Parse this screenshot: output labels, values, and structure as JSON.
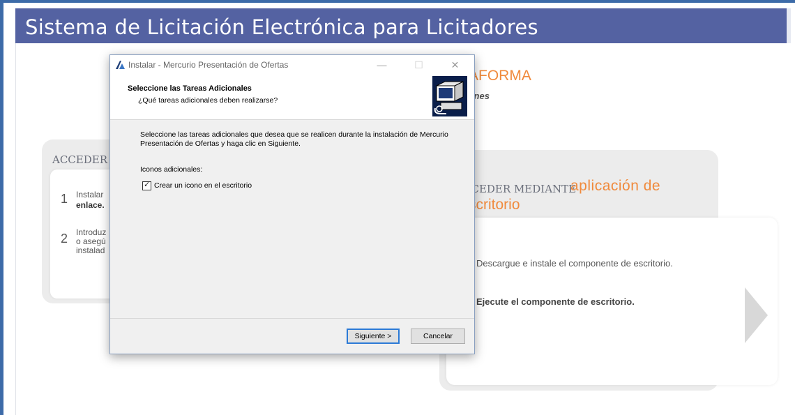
{
  "page": {
    "header_title": "Sistema de Licitación Electrónica para Licitadores",
    "plataforma_fragment": "AFORMA",
    "ciones_fragment": "iones",
    "left_card": {
      "acceder": "ACCEDER",
      "step1_num": "1",
      "step1_line1": "Instalar",
      "step1_line2": "enlace.",
      "step2_num": "2",
      "step2_line1": "Introduz",
      "step2_line2": "o asegú",
      "step2_line3": "instalad"
    },
    "right_card": {
      "acceder_mediante": "CCEDER MEDIANTE",
      "aplicacion": "aplicación de",
      "escritorio": "scritorio",
      "descargue": "Descargue e instale el componente de escritorio.",
      "ejecute": "Ejecute el componente de escritorio."
    }
  },
  "dialog": {
    "title": "Instalar - Mercurio Presentación de Ofertas",
    "minimize": "—",
    "maximize": "☐",
    "close": "✕",
    "header_main": "Seleccione las Tareas Adicionales",
    "header_sub": "¿Qué tareas adicionales deben realizarse?",
    "body_text": "Seleccione las tareas adicionales que desea que se realicen durante la instalación de Mercurio Presentación de Ofertas y haga clic en Siguiente.",
    "icons_label": "Iconos adicionales:",
    "checkbox_label": "Crear un icono en el escritorio",
    "checkbox_checked": true,
    "checkmark_glyph": "✓",
    "next_button": "Siguiente >",
    "cancel_button": "Cancelar"
  },
  "colors": {
    "header_bg": "#5462a2",
    "accent_orange": "#f08a3c",
    "dialog_focus": "#2c7ad6"
  }
}
